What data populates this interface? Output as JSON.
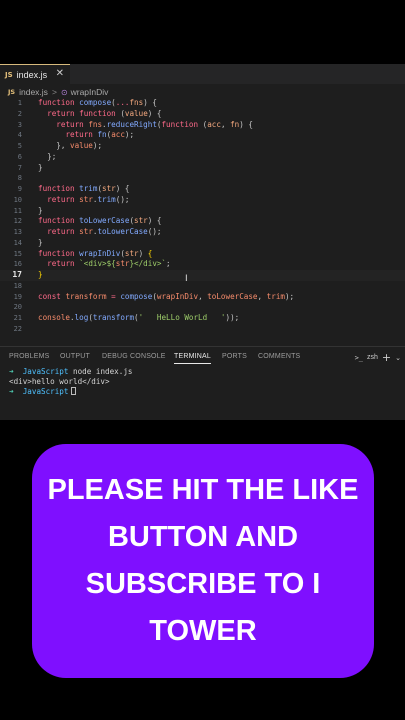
{
  "editor": {
    "tab": {
      "badge": "JS",
      "filename": "index.js",
      "close": "✕"
    },
    "breadcrumb": {
      "file": "index.js",
      "separator": ">",
      "symbol": "wrapInDiv"
    },
    "active_line": "17",
    "lines": [
      {
        "n": "1",
        "tokens": [
          [
            "kw",
            "function "
          ],
          [
            "fnn",
            "compose"
          ],
          [
            "pu",
            "("
          ],
          [
            "kw",
            "..."
          ],
          [
            "prm",
            "fns"
          ],
          [
            "pu",
            ") {"
          ]
        ]
      },
      {
        "n": "2",
        "tokens": [
          [
            "plain",
            "  "
          ],
          [
            "kw",
            "return "
          ],
          [
            "kw",
            "function "
          ],
          [
            "pu",
            "("
          ],
          [
            "prm",
            "value"
          ],
          [
            "pu",
            ") {"
          ]
        ]
      },
      {
        "n": "3",
        "tokens": [
          [
            "plain",
            "    "
          ],
          [
            "kw",
            "return "
          ],
          [
            "id",
            "fns"
          ],
          [
            "pu",
            "."
          ],
          [
            "fnn",
            "reduceRight"
          ],
          [
            "pu",
            "("
          ],
          [
            "kw",
            "function "
          ],
          [
            "pu",
            "("
          ],
          [
            "prm",
            "acc"
          ],
          [
            "pu",
            ", "
          ],
          [
            "prm",
            "fn"
          ],
          [
            "pu",
            ") {"
          ]
        ]
      },
      {
        "n": "4",
        "tokens": [
          [
            "plain",
            "      "
          ],
          [
            "kw",
            "return "
          ],
          [
            "fnn",
            "fn"
          ],
          [
            "pu",
            "("
          ],
          [
            "id",
            "acc"
          ],
          [
            "pu",
            ");"
          ]
        ]
      },
      {
        "n": "5",
        "tokens": [
          [
            "plain",
            "    "
          ],
          [
            "pu",
            "}, "
          ],
          [
            "id",
            "value"
          ],
          [
            "pu",
            ");"
          ]
        ]
      },
      {
        "n": "6",
        "tokens": [
          [
            "plain",
            "  "
          ],
          [
            "pu",
            "};"
          ]
        ]
      },
      {
        "n": "7",
        "tokens": [
          [
            "pu",
            "}"
          ]
        ]
      },
      {
        "n": "8",
        "tokens": []
      },
      {
        "n": "9",
        "tokens": [
          [
            "kw",
            "function "
          ],
          [
            "fnn",
            "trim"
          ],
          [
            "pu",
            "("
          ],
          [
            "prm",
            "str"
          ],
          [
            "pu",
            ") {"
          ]
        ]
      },
      {
        "n": "10",
        "tokens": [
          [
            "plain",
            "  "
          ],
          [
            "kw",
            "return "
          ],
          [
            "id",
            "str"
          ],
          [
            "pu",
            "."
          ],
          [
            "fnn",
            "trim"
          ],
          [
            "pu",
            "();"
          ]
        ]
      },
      {
        "n": "11",
        "tokens": [
          [
            "pu",
            "}"
          ]
        ]
      },
      {
        "n": "12",
        "tokens": [
          [
            "kw",
            "function "
          ],
          [
            "fnn",
            "toLowerCase"
          ],
          [
            "pu",
            "("
          ],
          [
            "prm",
            "str"
          ],
          [
            "pu",
            ") {"
          ]
        ]
      },
      {
        "n": "13",
        "tokens": [
          [
            "plain",
            "  "
          ],
          [
            "kw",
            "return "
          ],
          [
            "id",
            "str"
          ],
          [
            "pu",
            "."
          ],
          [
            "fnn",
            "toLowerCase"
          ],
          [
            "pu",
            "();"
          ]
        ]
      },
      {
        "n": "14",
        "tokens": [
          [
            "pu",
            "}"
          ]
        ]
      },
      {
        "n": "15",
        "tokens": [
          [
            "kw",
            "function "
          ],
          [
            "fnn",
            "wrapInDiv"
          ],
          [
            "pu",
            "("
          ],
          [
            "prm",
            "str"
          ],
          [
            "pu",
            ") "
          ],
          [
            "br",
            "{"
          ]
        ]
      },
      {
        "n": "16",
        "tokens": [
          [
            "plain",
            "  "
          ],
          [
            "kw",
            "return "
          ],
          [
            "str",
            "`<div>${"
          ],
          [
            "id",
            "str"
          ],
          [
            "str",
            "}</div>`"
          ],
          [
            "pu",
            ";"
          ]
        ]
      },
      {
        "n": "17",
        "tokens": [
          [
            "br",
            "}"
          ]
        ]
      },
      {
        "n": "18",
        "tokens": []
      },
      {
        "n": "19",
        "tokens": [
          [
            "kw",
            "const "
          ],
          [
            "id",
            "transform "
          ],
          [
            "kw",
            "= "
          ],
          [
            "fnn",
            "compose"
          ],
          [
            "pu",
            "("
          ],
          [
            "id",
            "wrapInDiv"
          ],
          [
            "pu",
            ", "
          ],
          [
            "id",
            "toLowerCase"
          ],
          [
            "pu",
            ", "
          ],
          [
            "id",
            "trim"
          ],
          [
            "pu",
            ");"
          ]
        ]
      },
      {
        "n": "20",
        "tokens": []
      },
      {
        "n": "21",
        "tokens": [
          [
            "id",
            "console"
          ],
          [
            "pu",
            "."
          ],
          [
            "fnn",
            "log"
          ],
          [
            "pu",
            "("
          ],
          [
            "fnn",
            "transform"
          ],
          [
            "pu",
            "("
          ],
          [
            "str",
            "'   HeLLo WorLd   '"
          ],
          [
            "pu",
            "));"
          ]
        ]
      },
      {
        "n": "22",
        "tokens": []
      }
    ]
  },
  "panel": {
    "tabs": [
      "PROBLEMS",
      "OUTPUT",
      "DEBUG CONSOLE",
      "TERMINAL",
      "PORTS",
      "COMMENTS"
    ],
    "active_tab": "TERMINAL",
    "shell": "zsh",
    "plus": "+",
    "chevron": "⌄"
  },
  "terminal": {
    "arrow": "➜",
    "dir": "JavaScript",
    "command": "node index.js",
    "output": "<div>hello world</div>"
  },
  "banner": {
    "text": "PLEASE HIT THE LIKE BUTTON AND SUBSCRIBE TO I TOWER",
    "color": "#7f0fff"
  }
}
